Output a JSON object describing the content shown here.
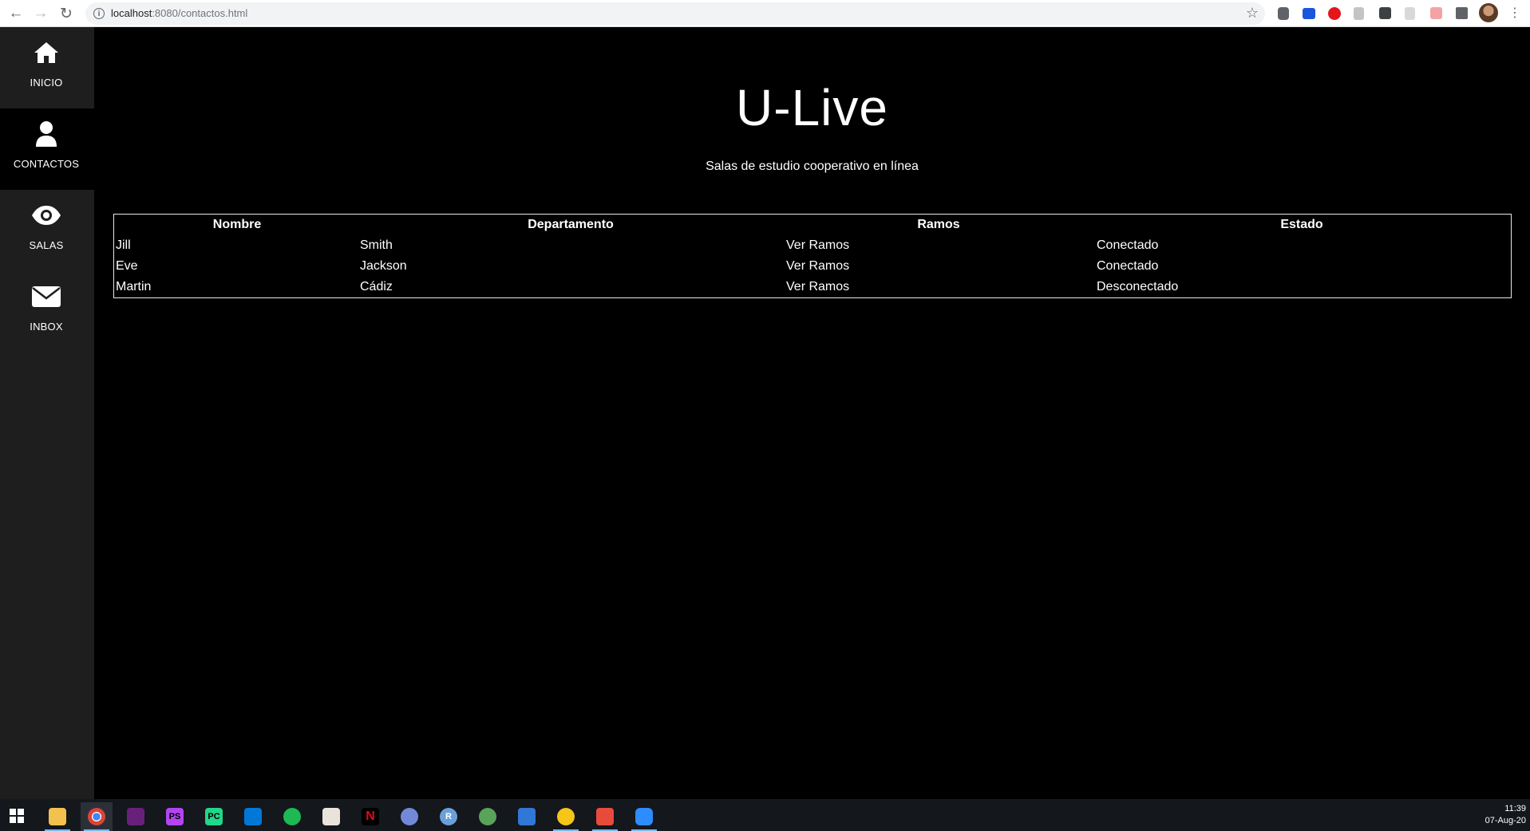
{
  "browser": {
    "url_host": "localhost",
    "url_path": ":8080/contactos.html"
  },
  "sidebar": {
    "items": [
      {
        "label": "INICIO",
        "icon": "home-icon"
      },
      {
        "label": "CONTACTOS",
        "icon": "user-icon",
        "active": true
      },
      {
        "label": "SALAS",
        "icon": "eye-icon"
      },
      {
        "label": "INBOX",
        "icon": "envelope-icon"
      }
    ]
  },
  "main": {
    "title": "U-Live",
    "subtitle": "Salas de estudio cooperativo en línea"
  },
  "table": {
    "headers": [
      "Nombre",
      "Departamento",
      "Ramos",
      "Estado"
    ],
    "rows": [
      [
        "Jill",
        "Smith",
        "Ver Ramos",
        "Conectado"
      ],
      [
        "Eve",
        "Jackson",
        "Ver Ramos",
        "Conectado"
      ],
      [
        "Martin",
        "Cádiz",
        "Ver Ramos",
        "Desconectado"
      ]
    ]
  },
  "taskbar": {
    "time": "11:39",
    "date": "07-Aug-20"
  },
  "colors": {
    "page_bg": "#000000",
    "sidebar_bg": "#1e1e1e",
    "text": "#ffffff",
    "table_border": "#e6e6e6"
  }
}
